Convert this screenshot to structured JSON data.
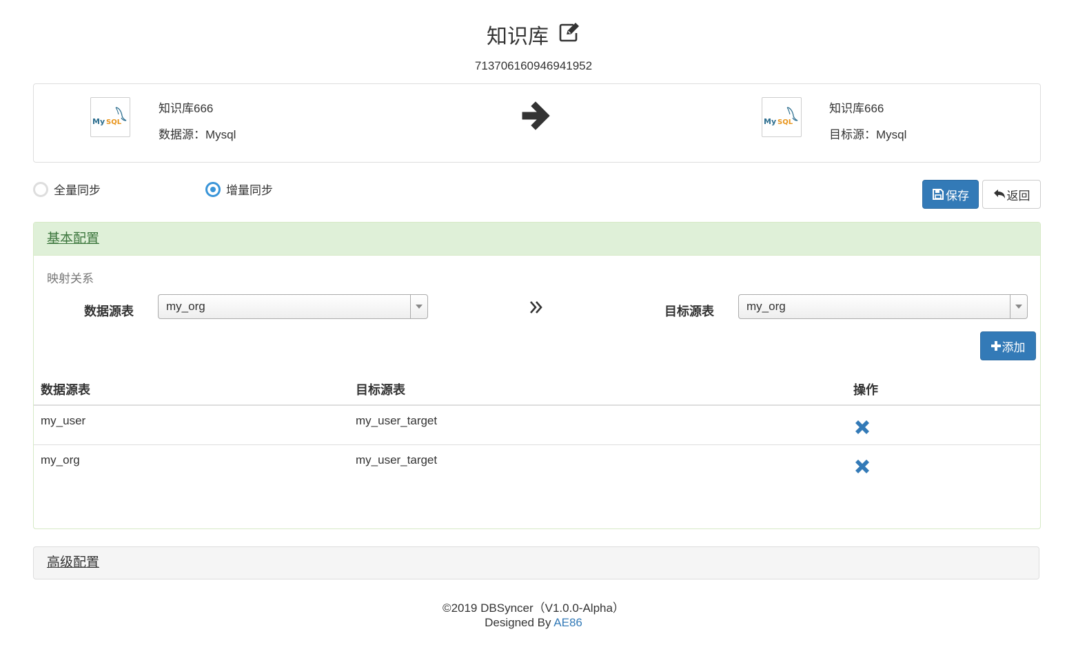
{
  "header": {
    "title": "知识库",
    "id": "713706160946941952"
  },
  "source": {
    "logo_text": "MySQL",
    "name": "知识库666",
    "type_label": "数据源：Mysql"
  },
  "target": {
    "logo_text": "MySQL",
    "name": "知识库666",
    "type_label": "目标源：Mysql"
  },
  "sync_mode": {
    "full_label": "全量同步",
    "incremental_label": "增量同步",
    "selected": "incremental"
  },
  "actions": {
    "save_label": "保存",
    "back_label": "返回"
  },
  "basic_panel": {
    "title": "基本配置",
    "mapping_label": "映射关系",
    "source_table_label": "数据源表",
    "source_table_value": "my_org",
    "target_table_label": "目标源表",
    "target_table_value": "my_org",
    "add_label": "添加",
    "table": {
      "headers": [
        "数据源表",
        "目标源表",
        "操作"
      ],
      "rows": [
        {
          "source": "my_user",
          "target": "my_user_target"
        },
        {
          "source": "my_org",
          "target": "my_user_target"
        }
      ]
    }
  },
  "advanced_panel": {
    "title": "高级配置"
  },
  "footer": {
    "copyright": "©2019 DBSyncer（V1.0.0-Alpha）",
    "designed_by": "Designed By ",
    "author_link": "AE86"
  },
  "colors": {
    "primary": "#337ab7",
    "success_bg": "#dff0d8",
    "radio_active": "#3a95d8",
    "delete_icon": "#337ab7"
  }
}
